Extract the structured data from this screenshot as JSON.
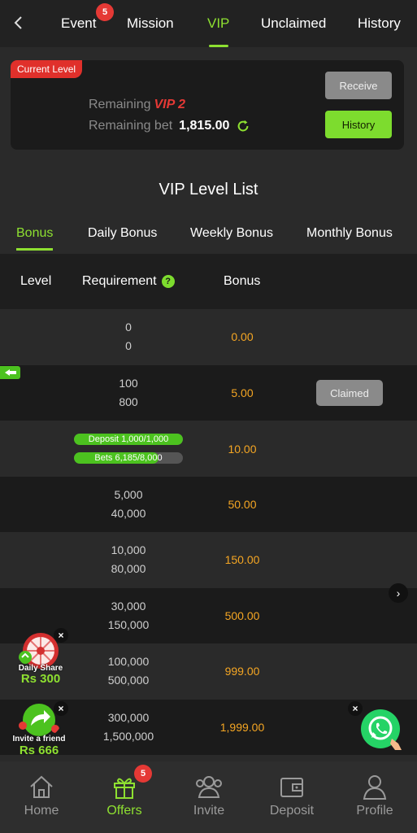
{
  "topnav": {
    "tabs": [
      {
        "label": "Event",
        "badge": "5"
      },
      {
        "label": "Mission"
      },
      {
        "label": "VIP"
      },
      {
        "label": "Unclaimed"
      },
      {
        "label": "History"
      }
    ],
    "active_tab": "VIP"
  },
  "level_card": {
    "tag": "Current Level",
    "remaining_label": "Remaining",
    "remaining_level": "VIP 2",
    "remaining_bet_label": "Remaining bet",
    "remaining_bet_value": "1,815.00",
    "receive_label": "Receive",
    "history_label": "History"
  },
  "list_title": "VIP Level List",
  "bonus_tabs": [
    "Bonus",
    "Daily Bonus",
    "Weekly Bonus",
    "Monthly Bonus"
  ],
  "table": {
    "headers": {
      "level": "Level",
      "requirement": "Requirement",
      "bonus": "Bonus",
      "help": "?"
    },
    "rows": [
      {
        "req1": "0",
        "req2": "0",
        "bonus": "0.00"
      },
      {
        "req1": "100",
        "req2": "800",
        "bonus": "5.00",
        "action": "Claimed"
      },
      {
        "deposit_label": "Deposit 1,000/1,000",
        "deposit_progress": 1.0,
        "bets_label": "Bets 6,185/8,000",
        "bets_progress": 0.773,
        "bonus": "10.00"
      },
      {
        "req1": "5,000",
        "req2": "40,000",
        "bonus": "50.00"
      },
      {
        "req1": "10,000",
        "req2": "80,000",
        "bonus": "150.00"
      },
      {
        "req1": "30,000",
        "req2": "150,000",
        "bonus": "500.00"
      },
      {
        "req1": "100,000",
        "req2": "500,000",
        "bonus": "999.00"
      },
      {
        "req1": "300,000",
        "req2": "1,500,000",
        "bonus": "1,999.00"
      }
    ]
  },
  "promos": {
    "daily_share": {
      "caption": "Daily Share",
      "amount": "Rs 300"
    },
    "invite": {
      "caption": "Invite a friend",
      "amount": "Rs 666"
    }
  },
  "bottombar": {
    "items": [
      {
        "label": "Home"
      },
      {
        "label": "Offers",
        "badge": "5"
      },
      {
        "label": "Invite"
      },
      {
        "label": "Deposit"
      },
      {
        "label": "Profile"
      }
    ],
    "active": "Offers"
  },
  "colors": {
    "accent": "#8ee031",
    "bonus": "#f5a623",
    "danger": "#e53935"
  }
}
